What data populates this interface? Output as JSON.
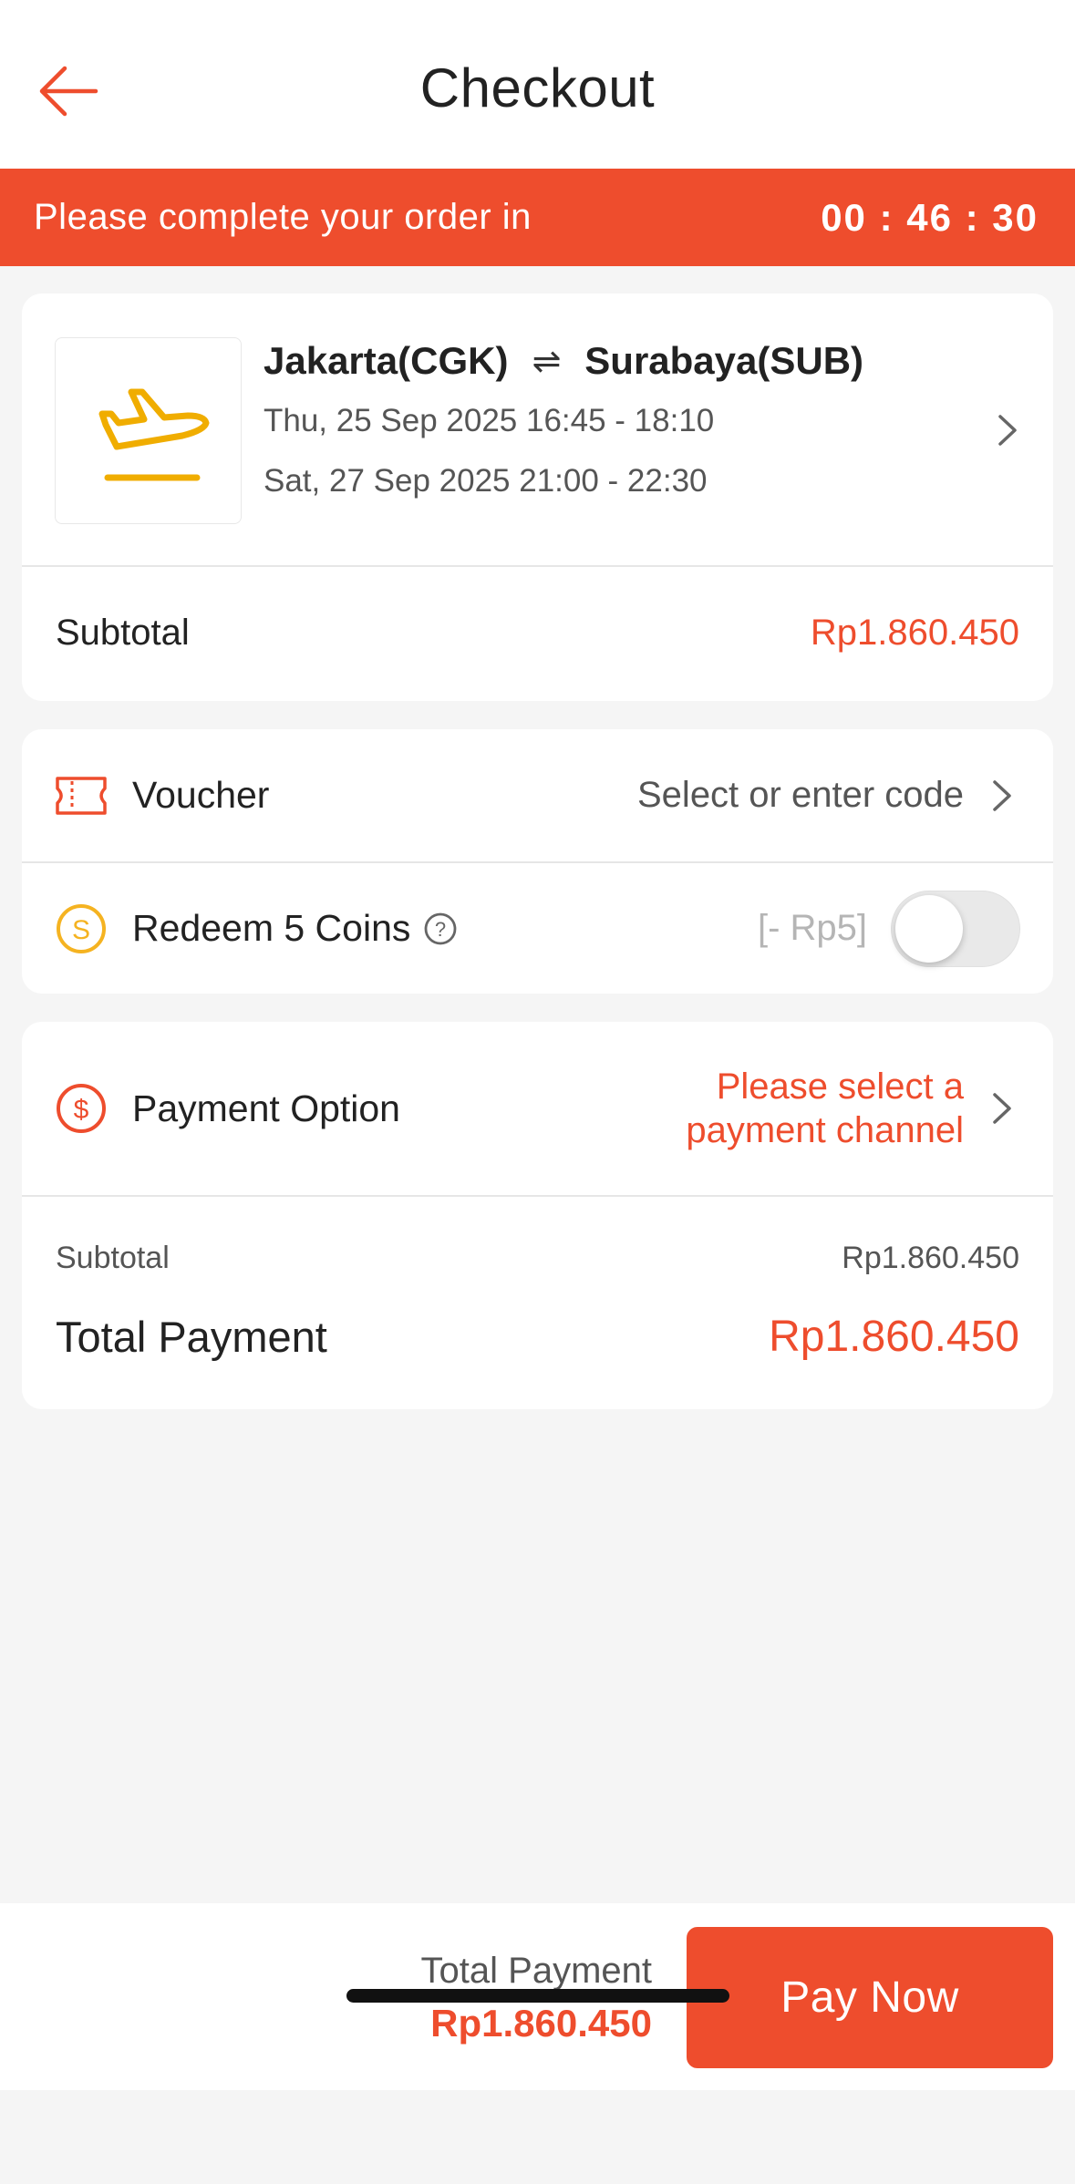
{
  "header": {
    "title": "Checkout"
  },
  "timer": {
    "message": "Please complete your order in",
    "countdown": "00 : 46 : 30"
  },
  "flight": {
    "origin": "Jakarta(CGK)",
    "swap_symbol": "⇌",
    "destination": "Surabaya(SUB)",
    "departure": "Thu, 25 Sep 2025 16:45 - 18:10",
    "return": "Sat, 27 Sep 2025 21:00 - 22:30",
    "subtotal_label": "Subtotal",
    "subtotal_value": "Rp1.860.450",
    "icon": "airplane-takeoff-icon"
  },
  "voucher": {
    "label": "Voucher",
    "hint": "Select or enter code",
    "icon": "ticket-icon"
  },
  "coins": {
    "label": "Redeem 5 Coins",
    "value": "[- Rp5]",
    "toggle_on": false,
    "icon": "coin-icon"
  },
  "payment": {
    "label": "Payment Option",
    "hint_line1": "Please select a",
    "hint_line2": "payment channel",
    "icon": "dollar-circle-icon",
    "subtotal_label": "Subtotal",
    "subtotal_value": "Rp1.860.450",
    "total_label": "Total Payment",
    "total_value": "Rp1.860.450"
  },
  "footer": {
    "total_label": "Total Payment",
    "total_value": "Rp1.860.450",
    "pay_button": "Pay Now"
  },
  "colors": {
    "accent": "#ee4d2d",
    "coin": "#f5b321",
    "plane": "#f0ad00"
  }
}
